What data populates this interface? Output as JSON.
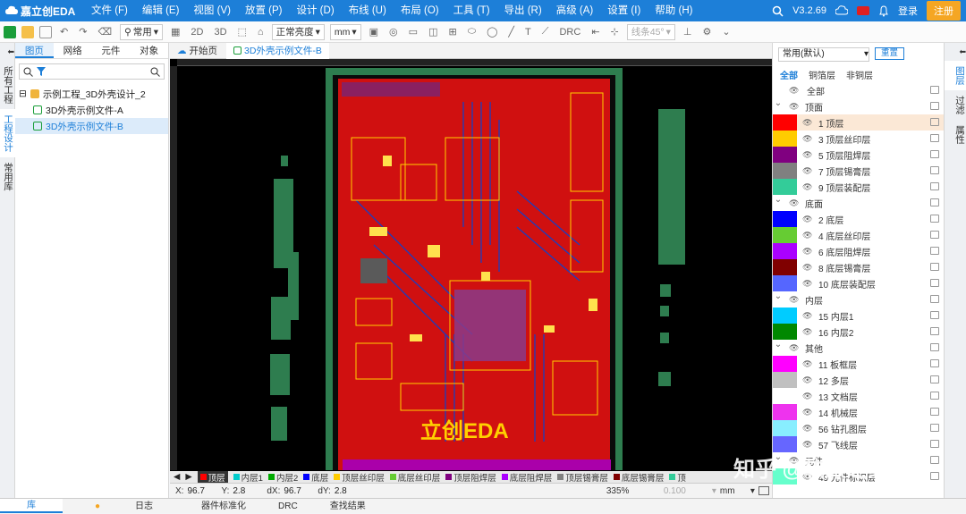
{
  "app": {
    "logo_text": "嘉立创EDA",
    "version": "V3.2.69",
    "login_label": "登录",
    "register_label": "注册",
    "brand_color": "#1d7fd8"
  },
  "menu": [
    "文件 (F)",
    "编辑 (E)",
    "视图 (V)",
    "放置 (P)",
    "设计 (D)",
    "布线 (U)",
    "布局 (O)",
    "工具 (T)",
    "导出 (R)",
    "高级 (A)",
    "设置 (I)",
    "帮助 (H)"
  ],
  "toolbar": {
    "filter_label": "常用",
    "view_2d": "2D",
    "view_3d": "3D",
    "brightness": "正常亮度",
    "unit": "mm",
    "drc_label": "DRC",
    "routing_mode": "线条45°"
  },
  "left_sidebar": [
    "所有工程",
    "工程设计",
    "常用库"
  ],
  "left_panel": {
    "tabs": [
      "图页",
      "网络",
      "元件",
      "对象"
    ],
    "tree": {
      "project": "示例工程_3D外壳设计_2",
      "files": [
        "3D外壳示例文件-A",
        "3D外壳示例文件-B"
      ]
    }
  },
  "doc_tabs": [
    "开始页",
    "3D外壳示例文件-B"
  ],
  "layer_tabs": [
    {
      "label": "顶层",
      "color": "#ff0000"
    },
    {
      "label": "内层1",
      "color": "#00cccc"
    },
    {
      "label": "内层2",
      "color": "#00aa00"
    },
    {
      "label": "底层",
      "color": "#0000ff"
    },
    {
      "label": "顶层丝印层",
      "color": "#ffcc00"
    },
    {
      "label": "底层丝印层",
      "color": "#66cc33"
    },
    {
      "label": "顶层阻焊层",
      "color": "#800080"
    },
    {
      "label": "底层阻焊层",
      "color": "#aa00ff"
    },
    {
      "label": "顶层锡膏层",
      "color": "#808080"
    },
    {
      "label": "底层锡膏层",
      "color": "#800000"
    },
    {
      "label": "顶",
      "color": "#33cc99"
    }
  ],
  "status": {
    "x_label": "X:",
    "x": "96.7",
    "y_label": "Y:",
    "y": "2.8",
    "dx_label": "dX:",
    "dx": "96.7",
    "dy_label": "dY:",
    "dy": "2.8",
    "zoom": "335%",
    "grid": "0.100",
    "unit": "mm"
  },
  "right_panel": {
    "preset": "常用(默认)",
    "reset_label": "重置",
    "filters": [
      "全部",
      "铜箔层",
      "非铜层"
    ],
    "layers": [
      {
        "label": "全部",
        "type": "group0",
        "color": ""
      },
      {
        "label": "顶面",
        "type": "group",
        "color": ""
      },
      {
        "label": "1 顶层",
        "type": "layer",
        "color": "#ff0000",
        "selected": true
      },
      {
        "label": "3 顶层丝印层",
        "type": "layer",
        "color": "#ffcc00"
      },
      {
        "label": "5 顶层阻焊层",
        "type": "layer",
        "color": "#800080"
      },
      {
        "label": "7 顶层锡膏层",
        "type": "layer",
        "color": "#808080"
      },
      {
        "label": "9 顶层装配层",
        "type": "layer",
        "color": "#33cc99"
      },
      {
        "label": "底面",
        "type": "group",
        "color": ""
      },
      {
        "label": "2 底层",
        "type": "layer",
        "color": "#0000ff"
      },
      {
        "label": "4 底层丝印层",
        "type": "layer",
        "color": "#66cc33"
      },
      {
        "label": "6 底层阻焊层",
        "type": "layer",
        "color": "#aa00ff"
      },
      {
        "label": "8 底层锡膏层",
        "type": "layer",
        "color": "#800000"
      },
      {
        "label": "10 底层装配层",
        "type": "layer",
        "color": "#5566ff"
      },
      {
        "label": "内层",
        "type": "group",
        "color": ""
      },
      {
        "label": "15 内层1",
        "type": "layer",
        "color": "#00ccff"
      },
      {
        "label": "16 内层2",
        "type": "layer",
        "color": "#008800"
      },
      {
        "label": "其他",
        "type": "group",
        "color": ""
      },
      {
        "label": "11 板框层",
        "type": "layer",
        "color": "#ff00ff"
      },
      {
        "label": "12 多层",
        "type": "layer",
        "color": "#c0c0c0"
      },
      {
        "label": "13 文档层",
        "type": "layer",
        "color": "#ffffff"
      },
      {
        "label": "14 机械层",
        "type": "layer",
        "color": "#ee33ee"
      },
      {
        "label": "56 钻孔图层",
        "type": "layer",
        "color": "#88eeff"
      },
      {
        "label": "57 飞线层",
        "type": "layer",
        "color": "#6666ff"
      },
      {
        "label": "元件",
        "type": "group",
        "color": ""
      },
      {
        "label": "49 元件标识层",
        "type": "layer",
        "color": "#66ffcc"
      }
    ]
  },
  "right_sidebar": [
    "图层",
    "过滤",
    "属性"
  ],
  "bottom_tabs": [
    "库",
    "日志",
    "器件标准化",
    "DRC",
    "查找结果"
  ],
  "pcb_logo_text": "立创EDA",
  "watermark": "知乎 @软服之家"
}
